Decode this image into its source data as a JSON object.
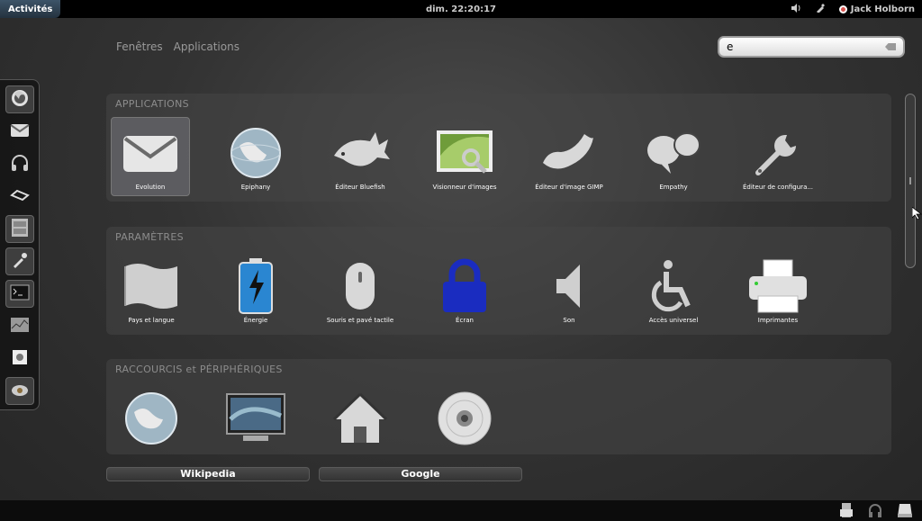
{
  "topbar": {
    "activities": "Activités",
    "clock": "dim. 22:20:17",
    "user": "Jack Holborn"
  },
  "view_tabs": [
    "Fenêtres",
    "Applications"
  ],
  "search": {
    "value": "e"
  },
  "dash": [
    "firefox-icon",
    "mail-icon",
    "headphones-icon",
    "link-icon",
    "file-cabinet-icon",
    "pen-tool-icon",
    "terminal-icon",
    "graph-icon",
    "document-icon",
    "screenshot-icon"
  ],
  "sections": {
    "applications": {
      "title": "APPLICATIONS",
      "items": [
        "Evolution",
        "Epiphany",
        "Éditeur Bluefish",
        "Visionneur d'images",
        "Éditeur d'image GIMP",
        "Empathy",
        "Éditeur de configura..."
      ]
    },
    "parametres": {
      "title": "PARAMÈTRES",
      "items": [
        "Pays et langue",
        "Énergie",
        "Souris et pavé tactile",
        "Écran",
        "Son",
        "Accès universel",
        "Imprimantes"
      ]
    },
    "raccourcis": {
      "title": "RACCOURCIS et PÉRIPHÉRIQUES",
      "links": [
        "Wikipedia",
        "Google"
      ]
    }
  },
  "colors": {
    "accent": "#3d5468",
    "lock_blue": "#1a2cc0"
  }
}
